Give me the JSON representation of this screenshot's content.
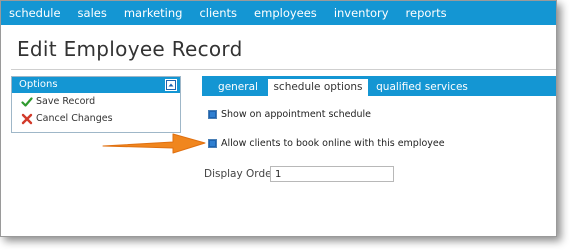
{
  "nav": {
    "items": [
      "schedule",
      "sales",
      "marketing",
      "clients",
      "employees",
      "inventory",
      "reports"
    ]
  },
  "page": {
    "title": "Edit Employee Record"
  },
  "options": {
    "header": "Options",
    "items": [
      {
        "label": "Save Record",
        "icon": "checkmark-icon"
      },
      {
        "label": "Cancel Changes",
        "icon": "x-icon"
      }
    ]
  },
  "tabs": {
    "items": [
      "general",
      "schedule options",
      "qualified services"
    ],
    "active": "schedule options"
  },
  "form": {
    "show_on_schedule_label": "Show on appointment schedule",
    "allow_online_booking_label": "Allow clients to book online with this employee",
    "display_order_label": "Display Order:",
    "display_order_value": "1"
  },
  "colors": {
    "brand": "#1496d3",
    "annotation_arrow": "#f0861e"
  }
}
